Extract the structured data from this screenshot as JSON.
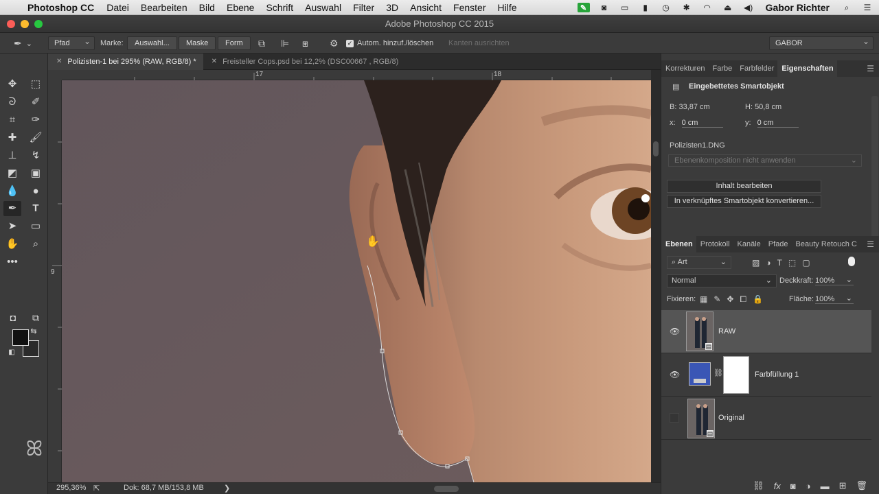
{
  "menubar": {
    "app_name": "Photoshop CC",
    "items": [
      "Datei",
      "Bearbeiten",
      "Bild",
      "Ebene",
      "Schrift",
      "Auswahl",
      "Filter",
      "3D",
      "Ansicht",
      "Fenster",
      "Hilfe"
    ],
    "user": "Gabor Richter"
  },
  "window": {
    "title": "Adobe Photoshop CC 2015"
  },
  "options": {
    "mode_select": "Pfad",
    "marke_label": "Marke:",
    "selection_button": "Auswahl...",
    "mask_button": "Maske",
    "shape_button": "Form",
    "auto_add_label": "Autom. hinzuf./löschen",
    "auto_add_checked": true,
    "align_edges_label": "Kanten ausrichten",
    "workspace_select": "GABOR"
  },
  "tabs": [
    {
      "label": "Polizisten-1 bei 295% (RAW, RGB/8) *",
      "close": "✕"
    },
    {
      "label": "Freisteller Cops.psd bei 12,2% (DSC00667 , RGB/8)",
      "close": "✕"
    }
  ],
  "rulers": {
    "h_labels": [
      "17",
      "18"
    ],
    "v_labels": [
      "9"
    ]
  },
  "statusbar": {
    "zoom": "295,36%",
    "doc_info": "Dok: 68,7 MB/153,8 MB",
    "arrow": "❯"
  },
  "properties": {
    "tabs": [
      "Korrekturen",
      "Farbe",
      "Farbfelder",
      "Eigenschaften"
    ],
    "active_tab": "Eigenschaften",
    "object_type": "Eingebettetes Smartobjekt",
    "b_label": "B:",
    "b_value": "33,87 cm",
    "h_label": "H:",
    "h_value": "50,8 cm",
    "x_label": "x:",
    "x_value": "0 cm",
    "y_label": "y:",
    "y_value": "0 cm",
    "file_name": "Polizisten1.DNG",
    "layer_comp_select": "Ebenenkomposition nicht anwenden",
    "edit_content_button": "Inhalt bearbeiten",
    "convert_button": "In verknüpftes Smartobjekt konvertieren..."
  },
  "layers_panel": {
    "tabs": [
      "Ebenen",
      "Protokoll",
      "Kanäle",
      "Pfade",
      "Beauty Retouch C"
    ],
    "active_tab": "Ebenen",
    "filter_kind": "Art",
    "blend_mode": "Normal",
    "opacity_label": "Deckkraft:",
    "opacity_value": "100%",
    "lock_label": "Fixieren:",
    "fill_label": "Fläche:",
    "fill_value": "100%",
    "layers": [
      {
        "name": "RAW",
        "visible": true,
        "selected": true
      },
      {
        "name": "Farbfüllung 1",
        "visible": true,
        "selected": false,
        "fill_color": "#3a56b5"
      },
      {
        "name": "Original",
        "visible": false,
        "selected": false
      }
    ]
  },
  "colors": {
    "foreground": "#111111",
    "background": "#2b2b2b"
  }
}
